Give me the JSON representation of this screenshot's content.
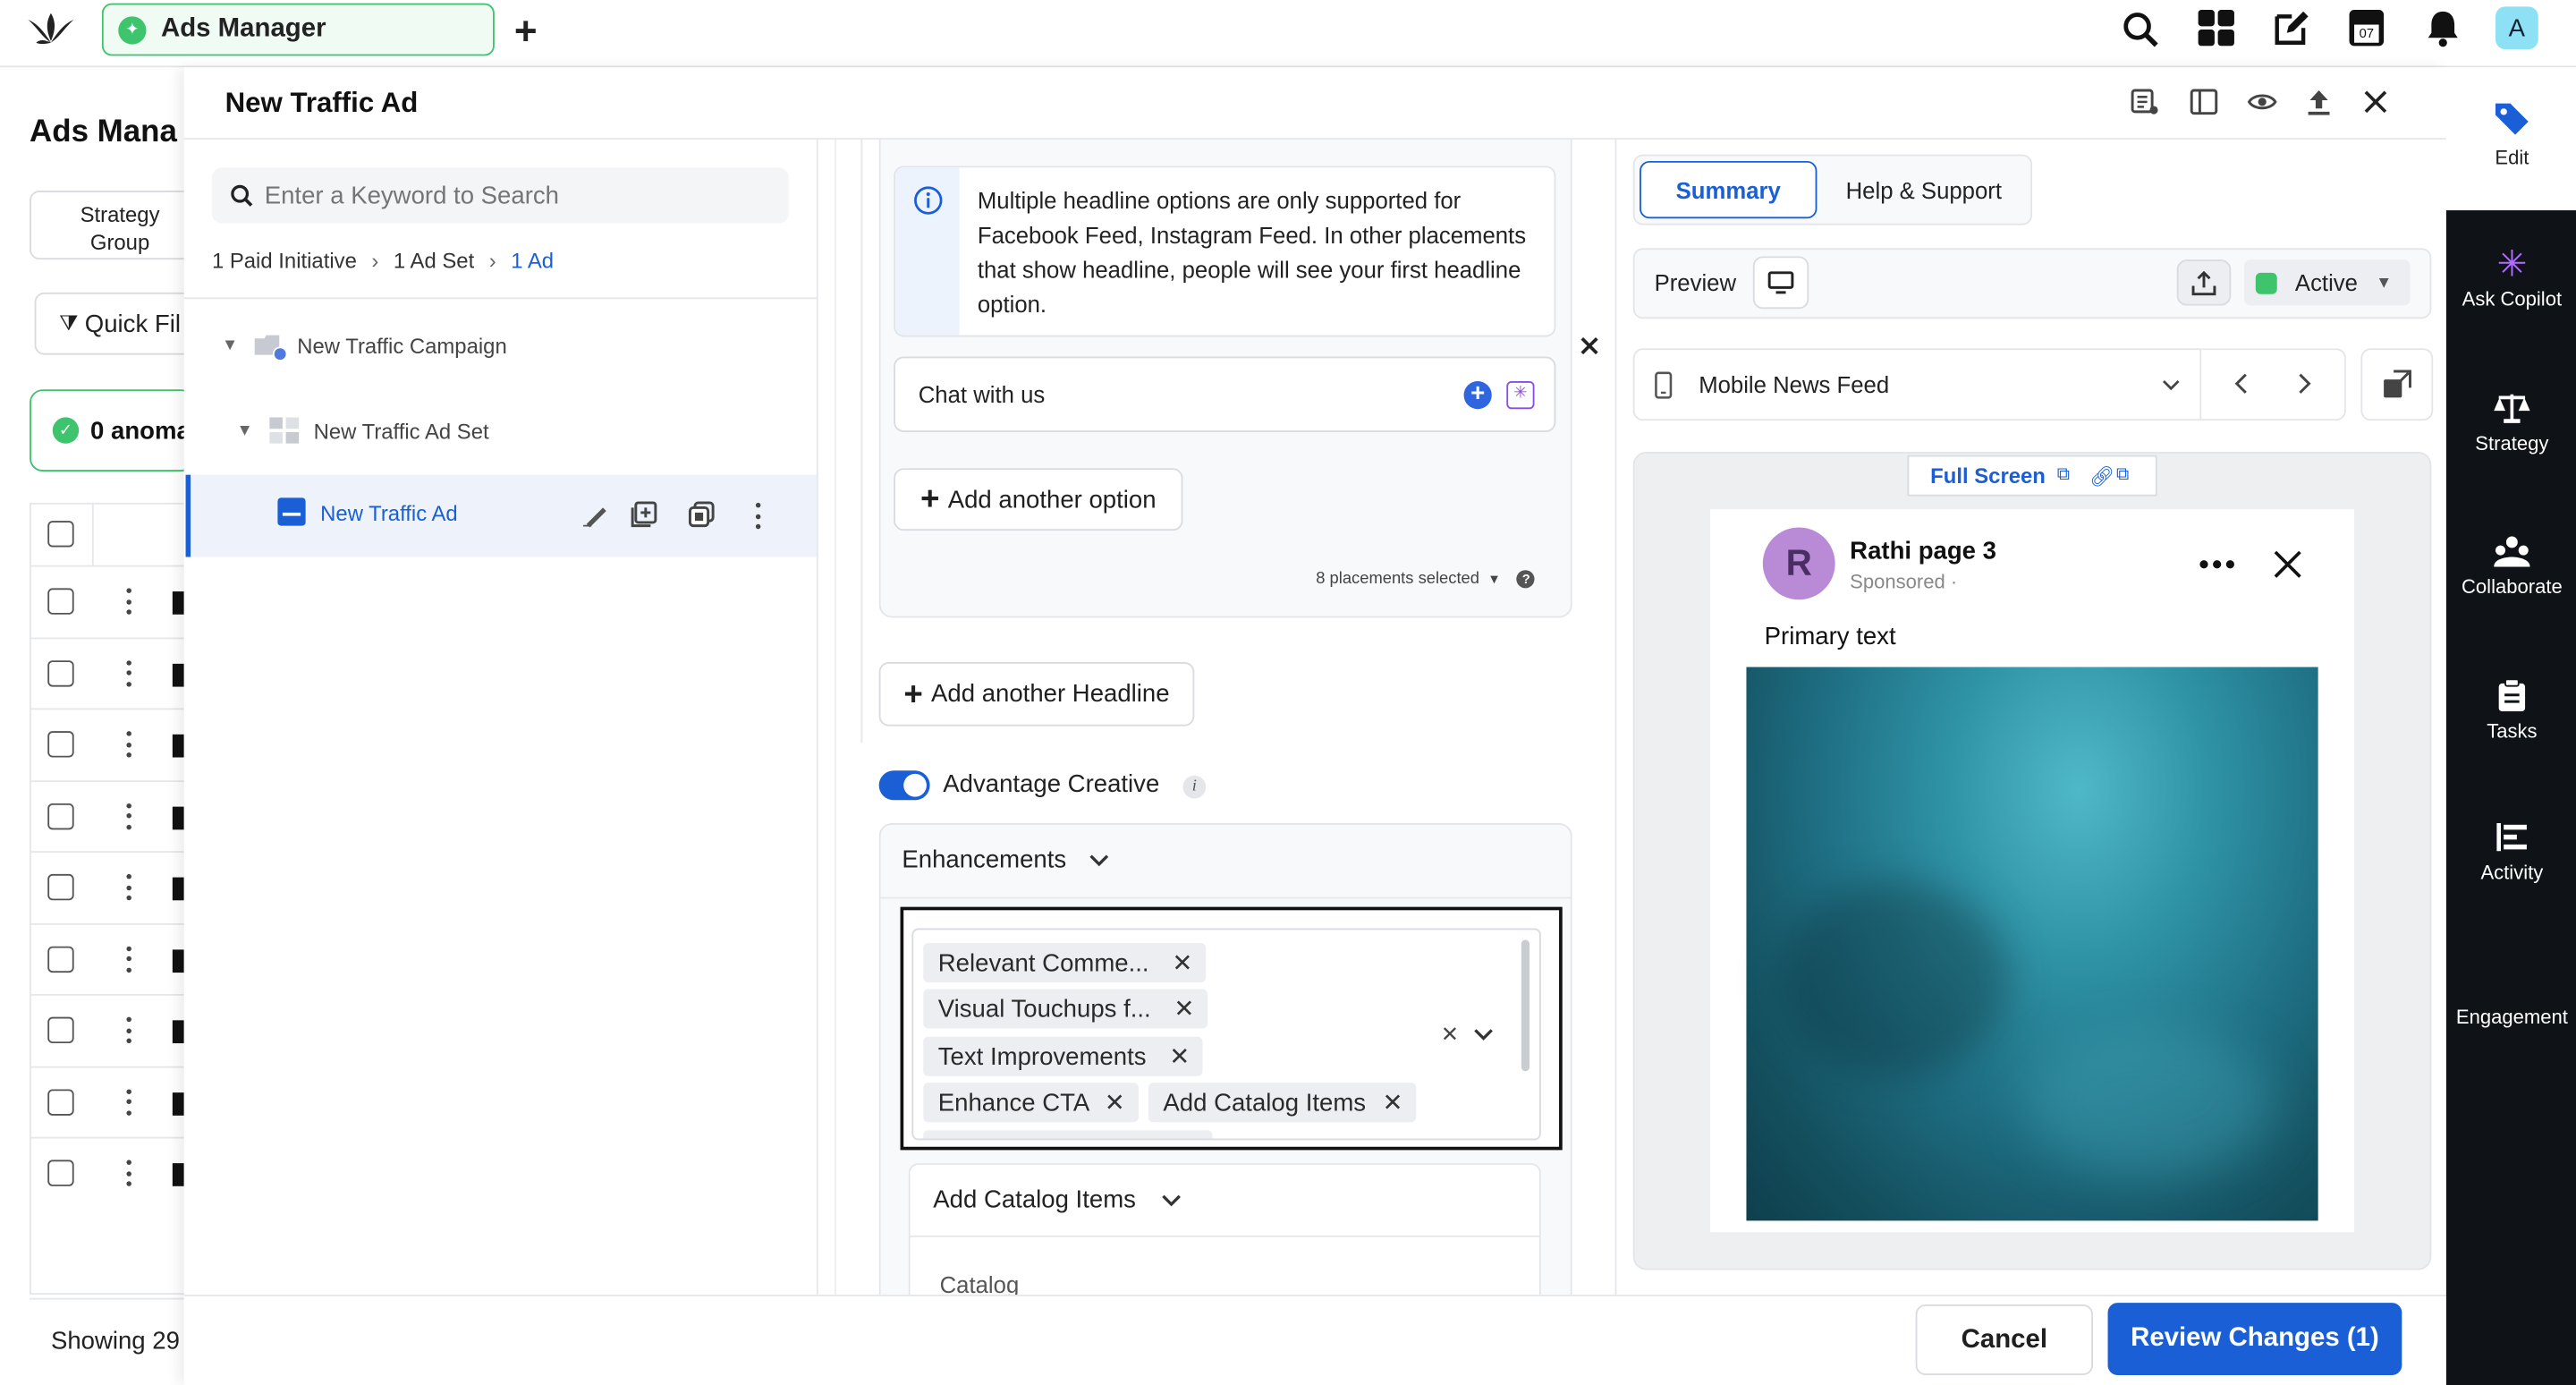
{
  "topbar": {
    "tab_title": "Ads Manager"
  },
  "background": {
    "page_title": "Ads Mana",
    "strategy_group": "Strategy Group",
    "quick_filter": "Quick Fil",
    "anomaly": "0 anoma",
    "showing": "Showing 29"
  },
  "drawer": {
    "title": "New Traffic Ad"
  },
  "tree": {
    "search_placeholder": "Enter a Keyword to Search",
    "breadcrumb": [
      "1 Paid Initiative",
      "1 Ad Set",
      "1 Ad"
    ],
    "campaign": "New Traffic Campaign",
    "adset": "New Traffic Ad Set",
    "ad": "New Traffic Ad"
  },
  "editor": {
    "info_text": "Multiple headline options are only supported for Facebook Feed, Instagram Feed. In other placements that show headline, people will see your first headline option.",
    "headline_value": "Chat with us",
    "add_option": "Add another option",
    "placements": "8 placements selected",
    "add_headline": "Add another Headline",
    "advantage_label": "Advantage Creative",
    "enhancements_label": "Enhancements",
    "chips": [
      "Relevant Comme...",
      "Visual Touchups f...",
      "Text Improvements",
      "Enhance CTA",
      "Add Catalog Items"
    ],
    "add_catalog_label": "Add Catalog Items",
    "catalog_label": "Catalog"
  },
  "preview": {
    "tabs": [
      "Summary",
      "Help & Support"
    ],
    "preview_label": "Preview",
    "status": "Active",
    "placement": "Mobile News Feed",
    "full_screen": "Full Screen",
    "page_name": "Rathi page 3",
    "avatar_letter": "R",
    "sponsored": "Sponsored ·",
    "primary_text": "Primary text"
  },
  "footer": {
    "cancel": "Cancel",
    "review": "Review Changes (1)"
  },
  "right_sidebar": {
    "edit": "Edit",
    "items": [
      "Ask Copilot",
      "Strategy",
      "Collaborate",
      "Tasks",
      "Activity",
      "Engagement"
    ]
  },
  "user_avatar": "A",
  "calendar_day": "07",
  "colors": {
    "accent": "#1a5fd6",
    "sidebar": "#0f1217",
    "active_green": "#3ec46d"
  }
}
